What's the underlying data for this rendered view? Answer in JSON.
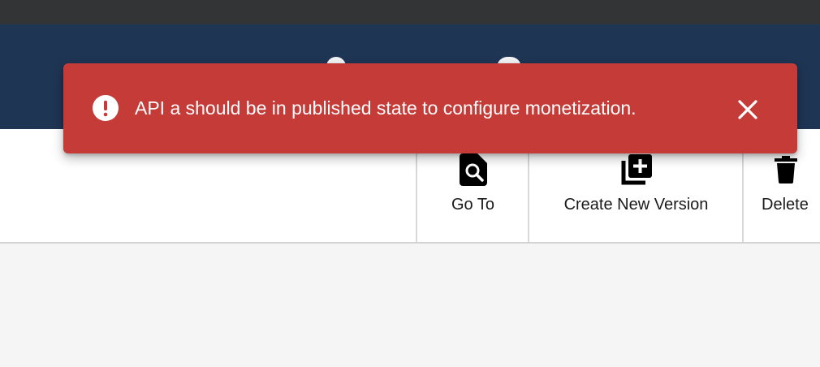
{
  "notification": {
    "type": "error",
    "message": "API a should be in published state to configure monetization.",
    "icon": "error-icon",
    "close_icon": "close-icon",
    "background_color": "#c43b38",
    "text_color": "#ffffff"
  },
  "header": {
    "background_color": "#1f3554"
  },
  "toolbar": {
    "actions": [
      {
        "label": "Go To",
        "icon": "file-search-icon"
      },
      {
        "label": "Create New Version",
        "icon": "library-add-icon"
      },
      {
        "label": "Delete",
        "icon": "trash-icon"
      }
    ]
  }
}
